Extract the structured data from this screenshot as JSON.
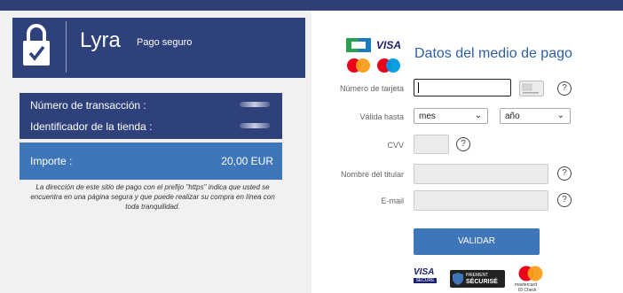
{
  "brand": {
    "name": "Lyra",
    "tagline": "Pago seguro"
  },
  "transaction": {
    "transaction_label": "Número de transacción :",
    "shop_label": "Identificador de la tienda :",
    "amount_label": "Importe :",
    "amount_value": "20,00 EUR"
  },
  "notice": "La dirección de este sitio de pago con el prefijo \"https\" indica que usted se encuentra en una página segura y que puede realizar su compra en línea con toda tranquilidad.",
  "form": {
    "title": "Datos del medio de pago",
    "card_number_label": "Número de tarjeta",
    "expiry_label": "Válida hasta",
    "month_value": "mes",
    "year_value": "año",
    "cvv_label": "CVV",
    "holder_label": "Nombre del titular",
    "email_label": "E-mail",
    "help_glyph": "?",
    "submit_label": "VALIDAR"
  },
  "logos": {
    "cb": "CB",
    "visa": "VISA",
    "visa_secure": "SECURE",
    "paiement_1": "PAIEMENT",
    "paiement_2": "SÉCURISÉ",
    "mc_id": "mastercard",
    "mc_id2": "ID Check"
  },
  "colors": {
    "brand_navy": "#2e417b",
    "accent_blue": "#3e76b9",
    "title_blue": "#2e5fa3"
  }
}
